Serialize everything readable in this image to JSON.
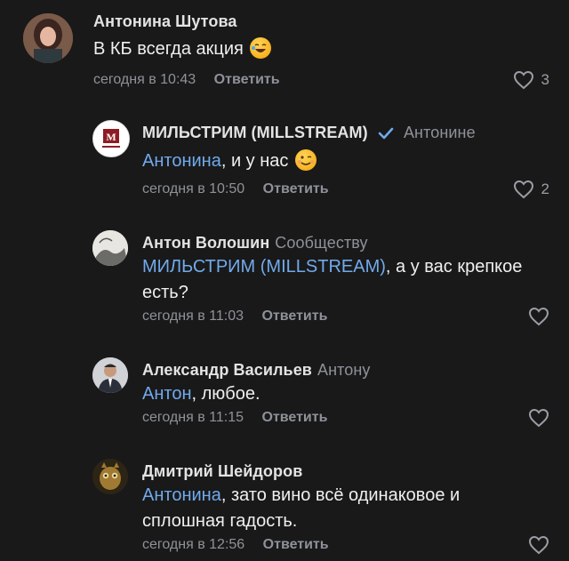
{
  "comments": [
    {
      "author": "Антонина Шутова",
      "reply_to": "",
      "mention": "",
      "text": "В КБ всегда акция",
      "emoji": "rofl-emoji",
      "time": "сегодня в 10:43",
      "reply_label": "Ответить",
      "likes": "3"
    },
    {
      "author": "МИЛЬСТРИМ (MILLSTREAM)",
      "reply_to": "Антонине",
      "mention": "Антонина",
      "text": ", и у нас",
      "emoji": "wink-emoji",
      "time": "сегодня в 10:50",
      "reply_label": "Ответить",
      "likes": "2"
    },
    {
      "author": "Антон Волошин",
      "reply_to": "Сообществу",
      "mention": "МИЛЬСТРИМ (MILLSTREAM)",
      "text": ", а у вас крепкое есть?",
      "time": "сегодня в 11:03",
      "reply_label": "Ответить",
      "likes": ""
    },
    {
      "author": "Александр Васильев",
      "reply_to": "Антону",
      "mention": "Антон",
      "text": ", любое.",
      "time": "сегодня в 11:15",
      "reply_label": "Ответить",
      "likes": ""
    },
    {
      "author": "Дмитрий Шейдоров",
      "reply_to": "",
      "mention": "Антонина",
      "text": ", зато вино всё одинаковое и сплошная гадость.",
      "time": "сегодня в 12:56",
      "reply_label": "Ответить",
      "likes": ""
    }
  ],
  "colors": {
    "background": "#19191a",
    "mention": "#71aaeb",
    "secondary": "#8e9298",
    "verified": "#71aaeb"
  }
}
